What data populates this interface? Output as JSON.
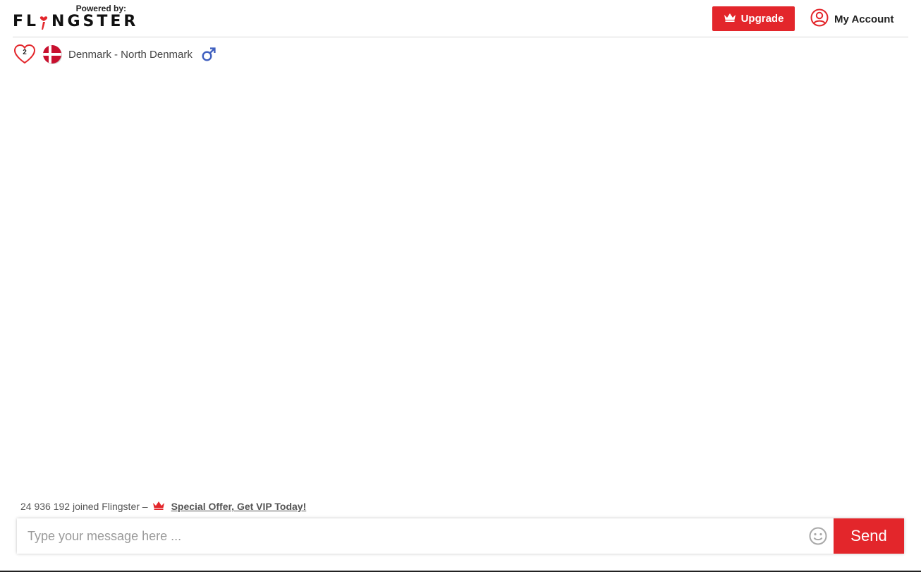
{
  "header": {
    "powered_by": "Powered by:",
    "brand": "FLINGSTER",
    "brand_prefix": "FL",
    "brand_suffix": "NGSTER",
    "upgrade_label": "Upgrade",
    "account_label": "My Account",
    "icons": {
      "upgrade": "crown-icon",
      "account": "user-circle-icon"
    }
  },
  "status": {
    "heart_count": "2",
    "location": "Denmark - North Denmark",
    "flag": "denmark-flag",
    "gender": "male"
  },
  "footer": {
    "joined_text": "24 936 192 joined Flingster –",
    "offer_link": "Special Offer, Get VIP Today!",
    "input_placeholder": "Type your message here ...",
    "input_value": "",
    "send_label": "Send",
    "icons": {
      "offer": "crown-icon",
      "emoji": "smiley-icon"
    }
  },
  "colors": {
    "accent": "#e3262b",
    "text_dark": "#222222",
    "text_muted": "#555555",
    "gender_icon": "#3f5fbf",
    "divider": "#d9d9d9"
  }
}
